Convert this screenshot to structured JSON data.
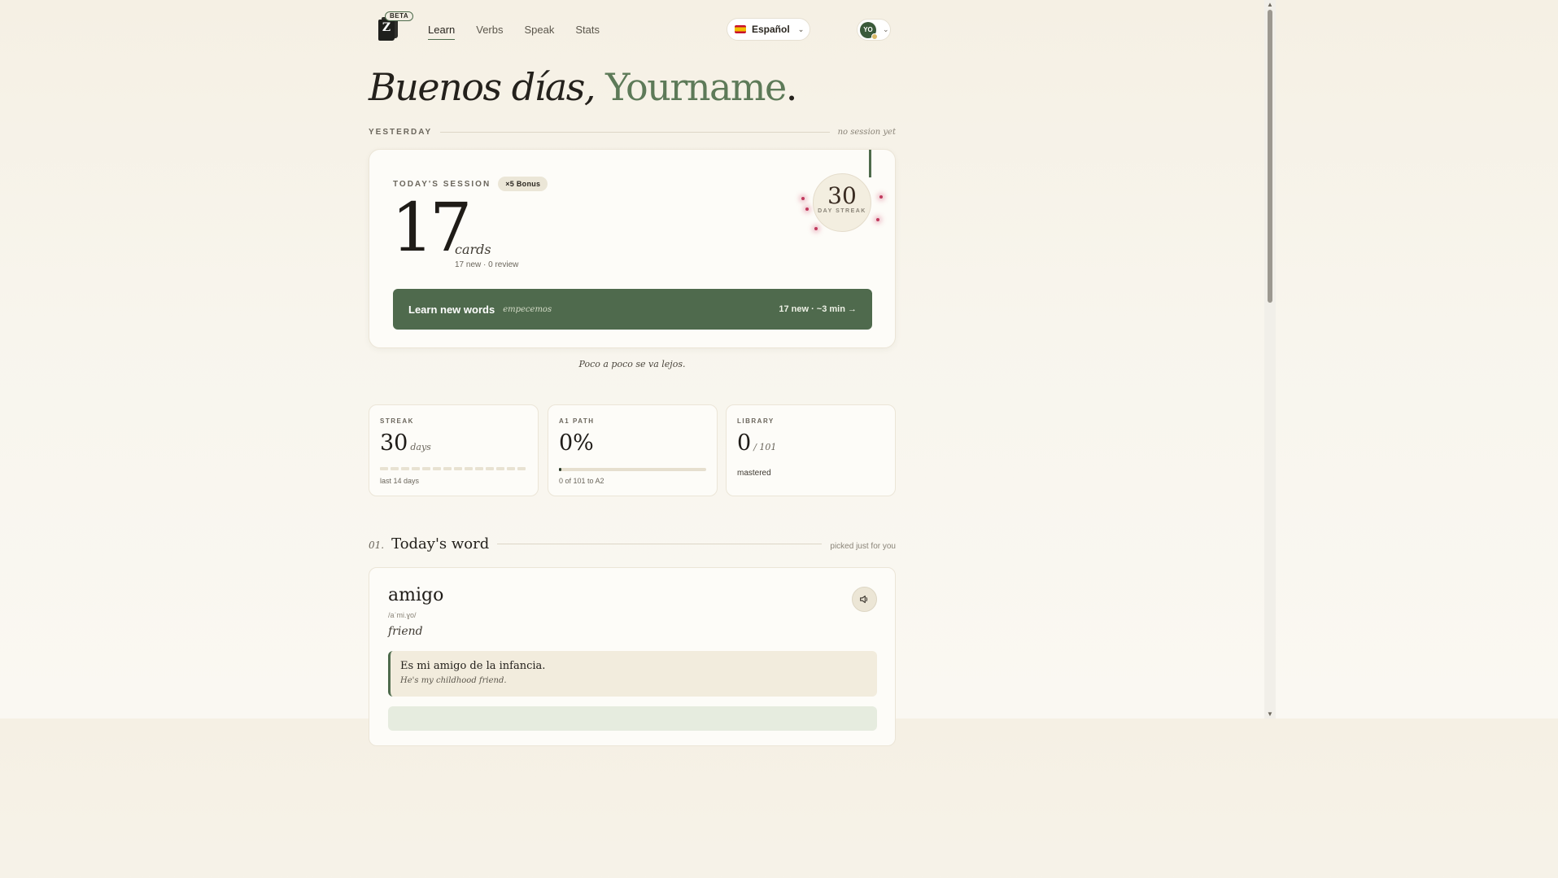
{
  "nav": {
    "logo_letter": "Z",
    "beta_label": "BETA",
    "links": [
      "Learn",
      "Verbs",
      "Speak",
      "Stats"
    ],
    "active_link": "Learn",
    "language": "Español",
    "avatar_initials": "YO"
  },
  "greeting": {
    "hello": "Buenos días,",
    "name": "Yourname",
    "period": "."
  },
  "yesterday": {
    "label": "YESTERDAY",
    "status": "no session yet"
  },
  "session": {
    "title": "TODAY'S SESSION",
    "bonus": "×5 Bonus",
    "count": "17",
    "unit": "cards",
    "breakdown": "17 new · 0 review",
    "streak_number": "30",
    "streak_label": "DAY STREAK",
    "cta_label": "Learn new words",
    "cta_spanish": "empecemos",
    "cta_meta": "17 new · ~3 min →"
  },
  "proverb": "Poco a poco se va lejos.",
  "stats": {
    "streak": {
      "label": "STREAK",
      "value": "30",
      "unit": "days",
      "footer": "last 14 days",
      "days_tracked": 14
    },
    "path": {
      "label": "A1 PATH",
      "value": "0%",
      "footer": "0 of 101 to A2",
      "progress": 0
    },
    "library": {
      "label": "LIBRARY",
      "value": "0",
      "unit": "/ 101",
      "footer": "mastered"
    }
  },
  "todays_word": {
    "number": "01.",
    "title": "Today's word",
    "subtitle": "picked just for you",
    "word": "amigo",
    "ipa": "/aˈmi.ɣo/",
    "translation": "friend",
    "example_es": "Es mi amigo de la infancia.",
    "example_en": "He's my childhood friend."
  },
  "colors": {
    "accent": "#4f6a4d",
    "name_green": "#5d7a58",
    "background": "#f7f3ea"
  }
}
